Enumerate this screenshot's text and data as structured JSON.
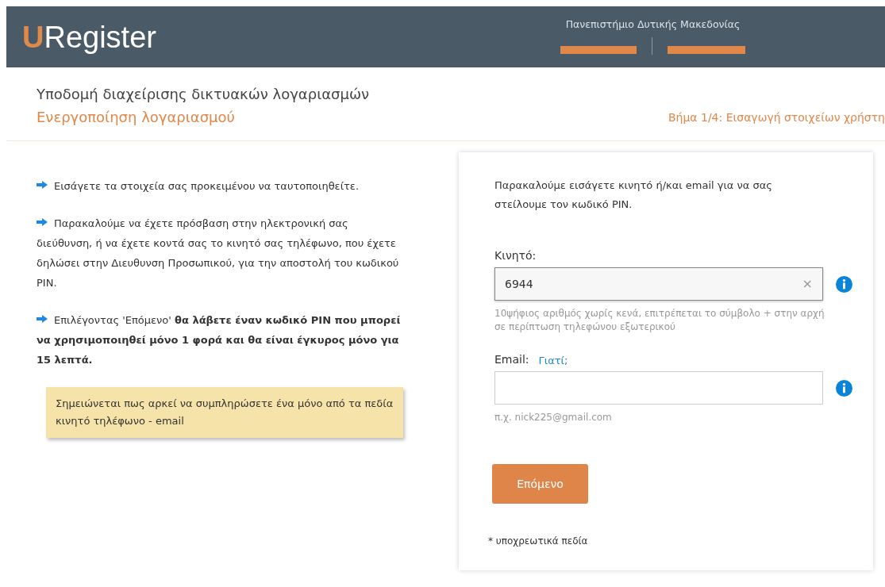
{
  "header": {
    "logo_letter": "U",
    "logo_rest": "Register",
    "institution": "Πανεπιστήμιο Δυτικής Μακεδονίας"
  },
  "page": {
    "title": "Υποδομή διαχείρισης δικτυακών λογαριασμών",
    "subtitle": "Ενεργοποίηση λογαριασμού",
    "step": "Βήμα 1/4: Εισαγωγή στοιχείων χρήστη"
  },
  "instructions": [
    {
      "text": "Εισάγετε τα στοιχεία σας προκειμένου να ταυτοποιηθείτε."
    },
    {
      "text": "Παρακαλούμε να έχετε πρόσβαση στην ηλεκτρονική σας διεύθυνση, ή να έχετε κοντά σας το κινητό σας τηλέφωνο, που έχετε δηλώσει στην Διευθυνση Προσωπικού, για την αποστολή του κωδικού PIN."
    },
    {
      "text": "Επιλέγοντας 'Επόμενο' **θα λάβετε έναν κωδικό PIN που μπορεί να χρησιμοποιηθεί μόνο 1 φορά και θα είναι έγκυρος μόνο για 15 λεπτά.**"
    }
  ],
  "note": "Σημειώνεται πως αρκεί να συμπληρώσετε ένα μόνο από τα πεδία κινητό τηλέφωνο - email",
  "form": {
    "intro": "Παρακαλούμε εισάγετε κινητό ή/και email για να σας στείλουμε τον κωδικό PIN.",
    "fields": [
      {
        "label": "Κινητό:",
        "value": "6944",
        "focused": true,
        "clear_icon": "×",
        "help": "10ψήφιος αριθμός χωρίς κενά, επιτρέπεται το σύμβολο + στην αρχή σε περίπτωση τηλεφώνου εξωτερικού"
      },
      {
        "label": "Email:",
        "link": "Γιατί;",
        "focused": false,
        "help": "π.χ. nick225@gmail.com"
      }
    ],
    "button": "Επόμενο",
    "footnote": "* υποχρεωτικά πεδία"
  }
}
